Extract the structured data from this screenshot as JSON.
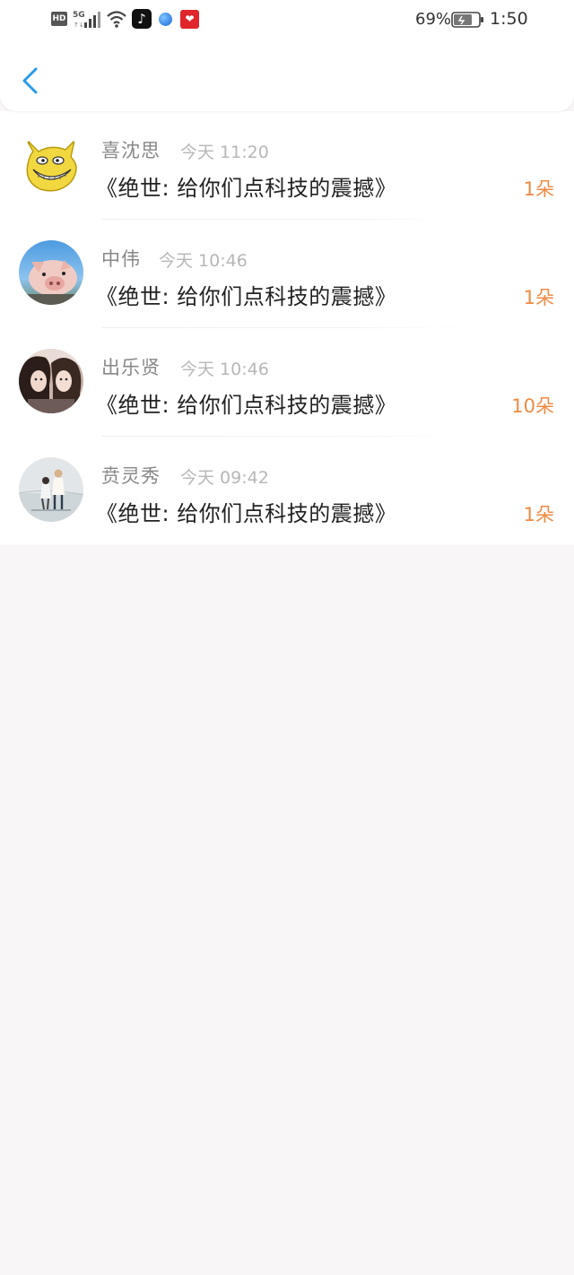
{
  "status_bar": {
    "hd_badge": "HD",
    "network": "5G",
    "battery_percent": "69%",
    "time": "1:50"
  },
  "header": {
    "back_icon": "chevron-left-icon",
    "accent_color": "#2a9be8"
  },
  "items": [
    {
      "name": "喜沈思",
      "time": "今天 11:20",
      "title": "《绝世: 给你们点科技的震撼》",
      "count": "1朵",
      "avatar": "yellow-cartoon-face"
    },
    {
      "name": "中伟",
      "time": "今天 10:46",
      "title": "《绝世: 给你们点科技的震撼》",
      "count": "1朵",
      "avatar": "pig-photo"
    },
    {
      "name": "出乐贤",
      "time": "今天 10:46",
      "title": "《绝世: 给你们点科技的震撼》",
      "count": "10朵",
      "avatar": "two-girls-photo"
    },
    {
      "name": "贲灵秀",
      "time": "今天 09:42",
      "title": "《绝世: 给你们点科技的震撼》",
      "count": "1朵",
      "avatar": "couple-winter-photo"
    }
  ],
  "colors": {
    "count": "#ef8a43",
    "name": "#888888",
    "time": "#b7b7b7",
    "title": "#222222",
    "background": "#f8f6f7"
  }
}
